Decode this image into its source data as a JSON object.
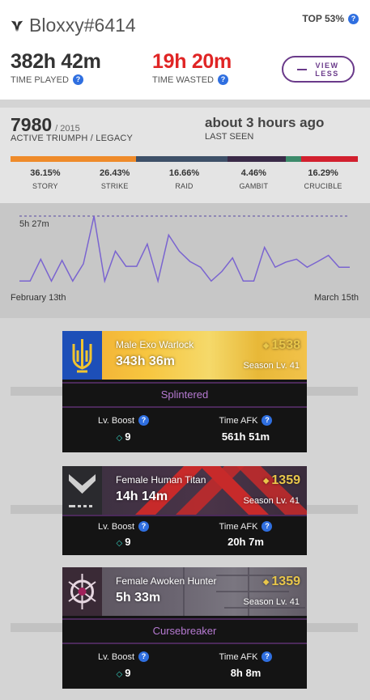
{
  "header": {
    "name": "Bloxxy#6414",
    "top_label": "TOP 53%",
    "time_played": {
      "value": "382h 42m",
      "label": "TIME PLAYED"
    },
    "time_wasted": {
      "value": "19h 20m",
      "label": "TIME WASTED"
    },
    "view_button": {
      "line1": "VIEW",
      "line2": "LESS"
    }
  },
  "triumph": {
    "score": "7980",
    "max": "/ 2015",
    "label": "ACTIVE TRIUMPH / LEGACY",
    "last_seen": "about 3 hours ago",
    "last_seen_label": "LAST SEEN",
    "breakdown": [
      {
        "name": "STORY",
        "pct_label": "36.15%",
        "pct": 36.15,
        "color": "#ef8b2a"
      },
      {
        "name": "STRIKE",
        "pct_label": "26.43%",
        "pct": 26.43,
        "color": "#3e5068"
      },
      {
        "name": "RAID",
        "pct_label": "16.66%",
        "pct": 16.66,
        "color": "#3a2a48"
      },
      {
        "name": "GAMBIT",
        "pct_label": "4.46%",
        "pct": 4.46,
        "color": "#3c8a6a"
      },
      {
        "name": "CRUCIBLE",
        "pct_label": "16.29%",
        "pct": 16.29,
        "color": "#d2202e"
      }
    ]
  },
  "chart_data": {
    "type": "line",
    "ymax_label": "5h 27m",
    "ymax_minutes": 327,
    "x_start_label": "February 13th",
    "x_end_label": "March 15th",
    "values_minutes": [
      18,
      18,
      122,
      18,
      116,
      18,
      100,
      327,
      18,
      160,
      88,
      88,
      194,
      18,
      237,
      160,
      111,
      84,
      18,
      64,
      128,
      18,
      18,
      178,
      84,
      108,
      122,
      84,
      111,
      140,
      84,
      84
    ],
    "line_color": "#7a64d0",
    "grid": false
  },
  "characters": [
    {
      "name": "Male Exo Warlock",
      "time": "343h 36m",
      "light": "1538",
      "season": "Season Lv. 41",
      "title": "Splintered",
      "boost_label": "Lv. Boost",
      "boost": "9",
      "afk_label": "Time AFK",
      "afk": "561h 51m",
      "emblem_icon": "trident-icon"
    },
    {
      "name": "Female Human Titan",
      "time": "14h 14m",
      "light": "1359",
      "season": "Season Lv. 41",
      "title": "",
      "boost_label": "Lv. Boost",
      "boost": "9",
      "afk_label": "Time AFK",
      "afk": "20h 7m",
      "emblem_icon": "chevron-emblem-icon"
    },
    {
      "name": "Female Awoken Hunter",
      "time": "5h 33m",
      "light": "1359",
      "season": "Season Lv. 41",
      "title": "Cursebreaker",
      "boost_label": "Lv. Boost",
      "boost": "9",
      "afk_label": "Time AFK",
      "afk": "8h 8m",
      "emblem_icon": "thorn-emblem-icon"
    }
  ]
}
